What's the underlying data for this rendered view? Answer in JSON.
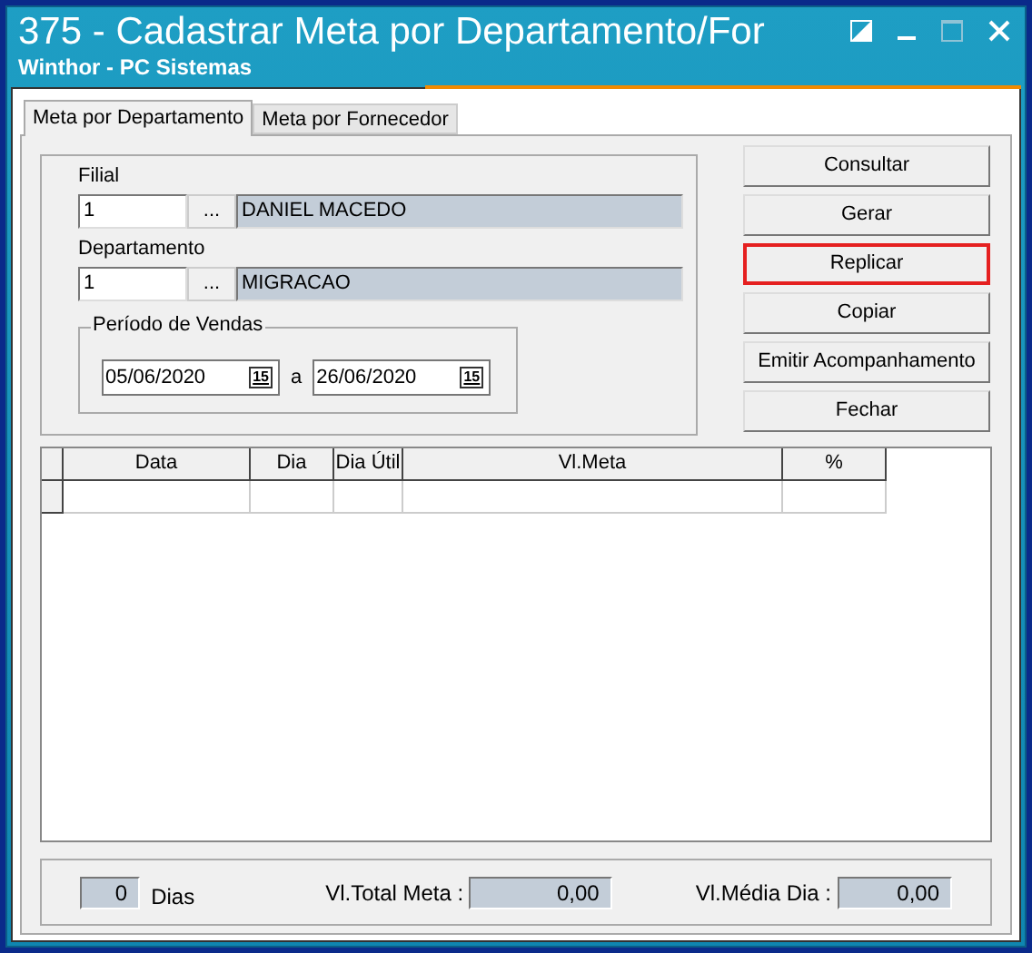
{
  "window": {
    "title": "375 - Cadastrar Meta por Departamento/For",
    "subtitle": "Winthor - PC Sistemas"
  },
  "tabs": [
    {
      "label": "Meta por Departamento",
      "selected": true
    },
    {
      "label": "Meta por Fornecedor",
      "selected": false
    }
  ],
  "filial": {
    "label": "Filial",
    "code": "1",
    "browse": "...",
    "name": "DANIEL MACEDO"
  },
  "departamento": {
    "label": "Departamento",
    "code": "1",
    "browse": "...",
    "name": "MIGRACAO"
  },
  "periodo": {
    "label": "Período de Vendas",
    "start": "05/06/2020",
    "separator": "a",
    "end": "26/06/2020",
    "start_calendar": "15",
    "end_calendar": "15"
  },
  "buttons": [
    {
      "label": "Consultar",
      "highlighted": false
    },
    {
      "label": "Gerar",
      "highlighted": false
    },
    {
      "label": "Replicar",
      "highlighted": true
    },
    {
      "label": "Copiar",
      "highlighted": false
    },
    {
      "label": "Emitir Acompanhamento",
      "highlighted": false
    },
    {
      "label": "Fechar",
      "highlighted": false
    }
  ],
  "table": {
    "columns": [
      "Data",
      "Dia",
      "Dia Útil",
      "Vl.Meta",
      "%"
    ]
  },
  "footer": {
    "dias_value": "0",
    "dias_label": "Dias",
    "total_label": "Vl.Total Meta :",
    "total_value": "0,00",
    "media_label": "Vl.Média Dia :",
    "media_value": "0,00"
  }
}
